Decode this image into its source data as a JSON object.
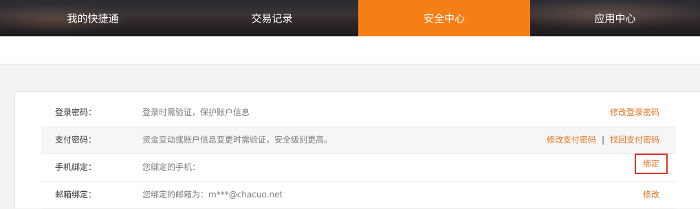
{
  "nav": {
    "tabs": [
      {
        "label": "我的快捷通"
      },
      {
        "label": "交易记录"
      },
      {
        "label": "安全中心"
      },
      {
        "label": "应用中心"
      }
    ],
    "active_color": "#f57f17"
  },
  "security": {
    "rows": [
      {
        "label": "登录密码：",
        "desc": "登录时需验证，保护账户信息",
        "actions": [
          "修改登录密码"
        ]
      },
      {
        "label": "支付密码：",
        "desc": "资金变动或账户信息变更时需验证，安全级别更高。",
        "actions": [
          "修改支付密码",
          "找回支付密码"
        ],
        "separator": "|"
      },
      {
        "label": "手机绑定：",
        "desc": "您绑定的手机：",
        "actions": [
          "绑定"
        ]
      },
      {
        "label": "邮箱绑定：",
        "desc": "您绑定的邮箱为：m***@chacuo.net",
        "actions": [
          "修改"
        ]
      }
    ],
    "link_color": "#e8731e",
    "highlight_color": "#d9342b"
  }
}
